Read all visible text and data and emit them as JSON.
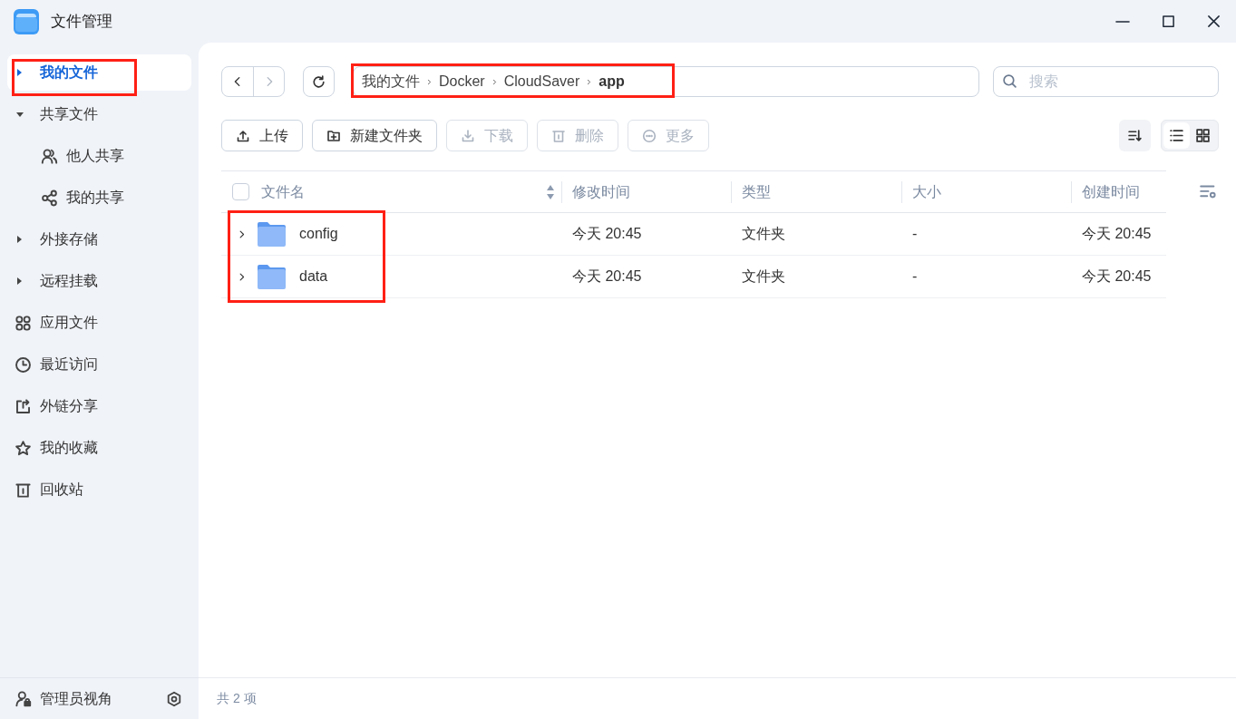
{
  "window": {
    "title": "文件管理"
  },
  "sidebar": {
    "items": [
      {
        "kind": "tree",
        "label": "我的文件",
        "expanded": false,
        "selected": true,
        "highlighted": true
      },
      {
        "kind": "tree",
        "label": "共享文件",
        "expanded": true,
        "selected": false,
        "children": [
          {
            "kind": "child",
            "label": "他人共享",
            "selected": false
          },
          {
            "kind": "child",
            "label": "我的共享",
            "selected": false
          }
        ]
      },
      {
        "kind": "tree",
        "label": "外接存储",
        "expanded": false,
        "selected": false
      },
      {
        "kind": "tree",
        "label": "远程挂载",
        "expanded": false,
        "selected": false
      },
      {
        "kind": "link",
        "label": "应用文件",
        "selected": false
      },
      {
        "kind": "link",
        "label": "最近访问",
        "selected": false
      },
      {
        "kind": "link",
        "label": "外链分享",
        "selected": false
      },
      {
        "kind": "link",
        "label": "我的收藏",
        "selected": false
      },
      {
        "kind": "link",
        "label": "回收站",
        "selected": false
      }
    ],
    "footer": {
      "label": "管理员视角"
    }
  },
  "navigation": {
    "back_disabled": false,
    "forward_disabled": true
  },
  "breadcrumb": {
    "highlighted": true,
    "segments": [
      {
        "label": "我的文件",
        "current": false
      },
      {
        "label": "Docker",
        "current": false
      },
      {
        "label": "CloudSaver",
        "current": false
      },
      {
        "label": "app",
        "current": true
      }
    ]
  },
  "search": {
    "placeholder": "搜索"
  },
  "toolbar": {
    "buttons": [
      {
        "label": "上传",
        "disabled": false
      },
      {
        "label": "新建文件夹",
        "disabled": false
      },
      {
        "label": "下载",
        "disabled": true
      },
      {
        "label": "删除",
        "disabled": true
      },
      {
        "label": "更多",
        "disabled": true
      }
    ]
  },
  "view_toggle": [
    {
      "kind": "list",
      "selected": true
    },
    {
      "kind": "grid",
      "selected": false
    }
  ],
  "file_table": {
    "select_all_checked": false,
    "name_column_highlighted": true,
    "columns": [
      "文件名",
      "修改时间",
      "类型",
      "大小",
      "创建时间"
    ],
    "rows": [
      {
        "name": "config",
        "modified": "今天 20:45",
        "type": "文件夹",
        "size": "-",
        "created": "今天 20:45"
      },
      {
        "name": "data",
        "modified": "今天 20:45",
        "type": "文件夹",
        "size": "-",
        "created": "今天 20:45"
      }
    ]
  },
  "status_bar": {
    "count": "共 2 项"
  }
}
